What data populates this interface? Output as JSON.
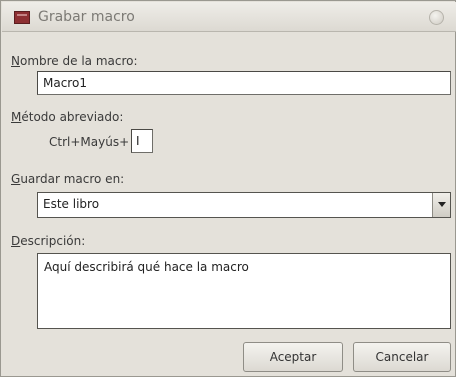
{
  "window": {
    "title": "Grabar macro",
    "icon": "macro-record-icon",
    "close_icon": "close-icon"
  },
  "macro_name": {
    "label_mnemonic": "N",
    "label_rest": "ombre de la macro:",
    "value": "Macro1"
  },
  "shortcut": {
    "label_mnemonic": "M",
    "label_rest": "étodo abreviado:",
    "prefix": "Ctrl+Mayús+",
    "value": "I"
  },
  "store_in": {
    "label_mnemonic": "G",
    "label_rest": "uardar macro en:",
    "selected": "Este libro"
  },
  "description": {
    "label_mnemonic": "D",
    "label_rest": "escripción:",
    "value": "Aquí describirá qué hace la macro"
  },
  "buttons": {
    "ok": "Aceptar",
    "cancel": "Cancelar"
  }
}
